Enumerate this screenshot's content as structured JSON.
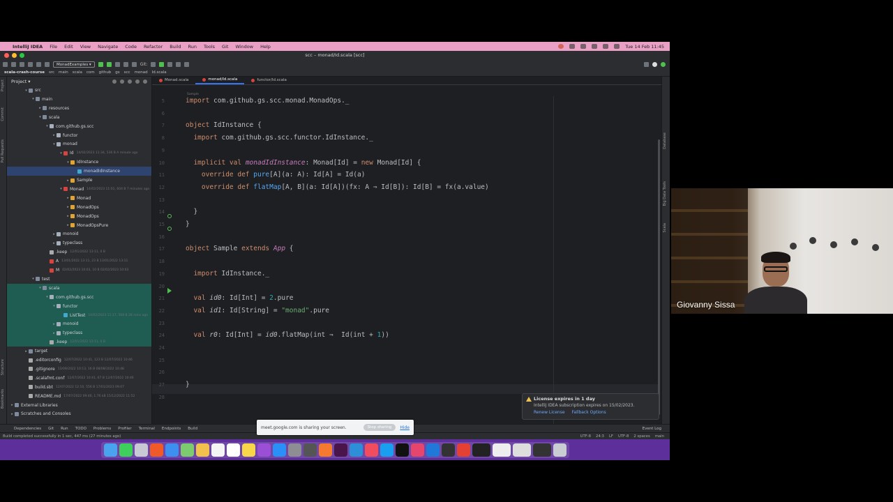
{
  "menubar": {
    "app": "IntelliJ IDEA",
    "items": [
      "File",
      "Edit",
      "View",
      "Navigate",
      "Code",
      "Refactor",
      "Build",
      "Run",
      "Tools",
      "Git",
      "Window",
      "Help"
    ],
    "datetime": "Tue 14 Feb  11:45"
  },
  "window": {
    "title": "scc – monad/Id.scala [scc]"
  },
  "toolbar": {
    "run_config": "MonadExamples ▾",
    "git_label": "Git:"
  },
  "breadcrumb": [
    "scala-crash-course",
    "src",
    "main",
    "scala",
    "com",
    "github",
    "gs",
    "scc",
    "monad",
    "Id.scala"
  ],
  "project": {
    "header": "Project ▾",
    "tree": [
      {
        "label": "src",
        "meta": "",
        "icon": "folder",
        "depth": 2,
        "arrow": "▾"
      },
      {
        "label": "main",
        "meta": "",
        "icon": "folder",
        "depth": 3,
        "arrow": "▾"
      },
      {
        "label": "resources",
        "meta": "",
        "icon": "folder",
        "depth": 4,
        "arrow": "▸"
      },
      {
        "label": "scala",
        "meta": "",
        "icon": "folder",
        "depth": 4,
        "arrow": "▾"
      },
      {
        "label": "com.github.gs.scc",
        "meta": "",
        "icon": "pkg",
        "depth": 5,
        "arrow": "▾"
      },
      {
        "label": "functor",
        "meta": "",
        "icon": "pkg",
        "depth": 6,
        "arrow": "▸"
      },
      {
        "label": "monad",
        "meta": "",
        "icon": "pkg",
        "depth": 6,
        "arrow": "▾"
      },
      {
        "label": "Id",
        "meta": "14/02/2023 11:34, 536 B A minute ago",
        "icon": "scala",
        "depth": 7,
        "arrow": "▾"
      },
      {
        "label": "IdInstance",
        "meta": "",
        "icon": "obj",
        "depth": 8,
        "arrow": "▾"
      },
      {
        "label": "monadIdInstance",
        "meta": "",
        "icon": "cls",
        "depth": 9,
        "arrow": "",
        "selected": true
      },
      {
        "label": "Sample",
        "meta": "",
        "icon": "obj",
        "depth": 8,
        "arrow": "▸"
      },
      {
        "label": "Monad",
        "meta": "14/02/2023 11:01, 604 B 7 minutes ago",
        "icon": "scala",
        "depth": 7,
        "arrow": "▾"
      },
      {
        "label": "Monad",
        "meta": "",
        "icon": "obj",
        "depth": 8,
        "arrow": "▸"
      },
      {
        "label": "MonadOps",
        "meta": "",
        "icon": "obj",
        "depth": 8,
        "arrow": "▸"
      },
      {
        "label": "MonadOps",
        "meta": "",
        "icon": "obj",
        "depth": 8,
        "arrow": "▸"
      },
      {
        "label": "MonadOpsPure",
        "meta": "",
        "icon": "obj",
        "depth": 8,
        "arrow": "▸"
      },
      {
        "label": "monoid",
        "meta": "",
        "icon": "pkg",
        "depth": 6,
        "arrow": "▸"
      },
      {
        "label": "typeclass",
        "meta": "",
        "icon": "pkg",
        "depth": 6,
        "arrow": "▸"
      },
      {
        "label": ".keep",
        "meta": "12/01/2022 13:11, 0 B",
        "icon": "file",
        "depth": 5,
        "arrow": ""
      },
      {
        "label": "A",
        "meta": "13/01/2022 13:11, 23 B 13/01/2022 13:11",
        "icon": "scala",
        "depth": 5,
        "arrow": ""
      },
      {
        "label": "M",
        "meta": "02/02/2023 10:03, 10 B 02/02/2023 10:03",
        "icon": "scala",
        "depth": 5,
        "arrow": ""
      },
      {
        "label": "test",
        "meta": "",
        "icon": "folder",
        "depth": 3,
        "arrow": "▾"
      },
      {
        "label": "scala",
        "meta": "",
        "icon": "folder",
        "depth": 4,
        "arrow": "▾",
        "test": true
      },
      {
        "label": "com.github.gs.scc",
        "meta": "",
        "icon": "pkg",
        "depth": 5,
        "arrow": "▾",
        "test": true
      },
      {
        "label": "functor",
        "meta": "",
        "icon": "pkg",
        "depth": 6,
        "arrow": "▾",
        "test": true
      },
      {
        "label": "ListTest",
        "meta": "14/02/2023 11:17, 568 B 28 mins ago",
        "icon": "cls",
        "depth": 7,
        "arrow": "",
        "test": true
      },
      {
        "label": "monoid",
        "meta": "",
        "icon": "pkg",
        "depth": 6,
        "arrow": "▸",
        "test": true
      },
      {
        "label": "typeclass",
        "meta": "",
        "icon": "pkg",
        "depth": 6,
        "arrow": "▸",
        "test": true
      },
      {
        "label": ".keep",
        "meta": "12/01/2022 13:11, 0 B",
        "icon": "file",
        "depth": 5,
        "arrow": "",
        "test": true
      },
      {
        "label": "target",
        "meta": "",
        "icon": "folder",
        "depth": 2,
        "arrow": "▸"
      },
      {
        "label": ".editorconfig",
        "meta": "12/07/2022 10:41, 123 B 12/07/2022 10:46",
        "icon": "file",
        "depth": 2,
        "arrow": ""
      },
      {
        "label": ".gitignore",
        "meta": "13/09/2022 10:13, 16 B 08/08/2022 10:48",
        "icon": "file",
        "depth": 2,
        "arrow": ""
      },
      {
        "label": ".scalafmt.conf",
        "meta": "12/07/2022 10:41, 67 B 12/07/2022 10:46",
        "icon": "file",
        "depth": 2,
        "arrow": ""
      },
      {
        "label": "build.sbt",
        "meta": "12/07/2022 12:10, 556 B 17/01/2023 09:07",
        "icon": "file",
        "depth": 2,
        "arrow": ""
      },
      {
        "label": "README.md",
        "meta": "17/07/2022 09:46, 1.76 kB 15/12/2022 11:52",
        "icon": "file",
        "depth": 2,
        "arrow": ""
      },
      {
        "label": "External Libraries",
        "meta": "",
        "icon": "folder",
        "depth": 0,
        "arrow": "▸"
      },
      {
        "label": "Scratches and Consoles",
        "meta": "",
        "icon": "folder",
        "depth": 0,
        "arrow": "▸"
      }
    ]
  },
  "tabs": [
    {
      "label": "Monad.scala",
      "active": false
    },
    {
      "label": "monad/Id.scala",
      "active": true
    },
    {
      "label": "functor/Id.scala",
      "active": false
    }
  ],
  "editor": {
    "crumb": "Sample",
    "lines": [
      {
        "n": "5",
        "html": "<span class='kw'>import</span> com.github.gs.scc.monad.MonadOps._"
      },
      {
        "n": "6",
        "html": ""
      },
      {
        "n": "7",
        "html": "<span class='kw'>object</span> IdInstance {"
      },
      {
        "n": "8",
        "html": "  <span class='kw'>import</span> com.github.gs.scc.functor.IdInstance._"
      },
      {
        "n": "9",
        "html": ""
      },
      {
        "n": "10",
        "html": "  <span class='kw'>implicit val</span> <span class='it'>monadIdInstance</span>: Monad[Id] = <span class='kw'>new</span> Monad[Id] {"
      },
      {
        "n": "11",
        "html": "    <span class='kw'>override def</span> <span class='fn'>pure</span>[A](a: A): Id[A] = Id(a)"
      },
      {
        "n": "12",
        "html": "    <span class='kw'>override def</span> <span class='fn'>flatMap</span>[A, B](a: Id[A])(fx: A ⇒ Id[B]): Id[B] = fx(a.value)"
      },
      {
        "n": "13",
        "html": ""
      },
      {
        "n": "14",
        "html": "  }"
      },
      {
        "n": "15",
        "html": "}"
      },
      {
        "n": "16",
        "html": ""
      },
      {
        "n": "17",
        "html": "<span class='kw'>object</span> Sample <span class='kw'>extends</span> <span class='it'>App</span> {"
      },
      {
        "n": "18",
        "html": ""
      },
      {
        "n": "19",
        "html": "  <span class='kw'>import</span> IdInstance._"
      },
      {
        "n": "20",
        "html": ""
      },
      {
        "n": "21",
        "html": "  <span class='kw'>val</span> <span class='var'>id0</span>: Id[Int] = <span class='num'>2</span>.pure"
      },
      {
        "n": "22",
        "html": "  <span class='kw'>val</span> <span class='var'>id1</span>: Id[String] = <span class='str'>\"monad\"</span>.pure"
      },
      {
        "n": "23",
        "html": ""
      },
      {
        "n": "24",
        "html": "  <span class='kw'>val</span> <span class='var'>r0</span>: Id[Int] = <span class='var'>id0</span>.flatMap(int ⇒  Id(int + <span class='num'>1</span>))"
      },
      {
        "n": "24",
        "html": ""
      },
      {
        "n": "25",
        "html": ""
      },
      {
        "n": "26",
        "html": ""
      },
      {
        "n": "27",
        "html": "}"
      },
      {
        "n": "28",
        "html": ""
      }
    ]
  },
  "license": {
    "title": "License expires in 1 day",
    "body": "IntelliJ IDEA subscription expires on 15/02/2023.",
    "link1": "Renew License",
    "link2": "Fallback Options"
  },
  "bottom_tools": [
    "Dependencies",
    "Git",
    "Run",
    "TODO",
    "Problems",
    "Profiler",
    "Terminal",
    "Endpoints",
    "Build"
  ],
  "event_log": "Event Log",
  "status": {
    "message": "Build completed successfully in 1 sec, 447 ms (27 minutes ago)",
    "right": [
      "UTF-8",
      "24:3",
      "LF",
      "UTF-8",
      "2 spaces",
      "main"
    ]
  },
  "meet": {
    "text": "meet.google.com is sharing your screen.",
    "stop": "Stop sharing",
    "hide": "Hide"
  },
  "webcam": {
    "name": "Giovanny Sissa"
  },
  "colors": {
    "accent": "#3574f0",
    "menubar": "#e9a0c4",
    "dock": "#5d2f9a",
    "editor_bg": "#1e1f22"
  }
}
